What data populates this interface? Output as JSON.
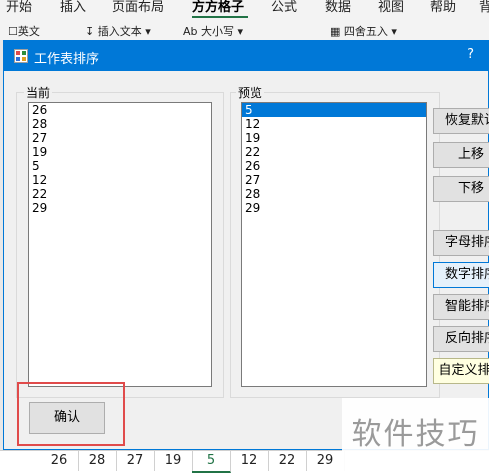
{
  "ribbon": {
    "tabs": [
      "开始",
      "插入",
      "页面布局",
      "方方格子",
      "公式",
      "数据",
      "视图",
      "帮助",
      "背"
    ],
    "toolbar": [
      "英文",
      "插入文本",
      "大小写",
      "四舍五入"
    ]
  },
  "dialog": {
    "title": "工作表排序",
    "help": "?",
    "current_label": "当前",
    "preview_label": "预览",
    "current_items": [
      "26",
      "28",
      "27",
      "19",
      "5",
      "12",
      "22",
      "29"
    ],
    "preview_items": [
      "5",
      "12",
      "19",
      "22",
      "26",
      "27",
      "28",
      "29"
    ],
    "preview_selected": "5",
    "buttons": {
      "restore": "恢复默认",
      "move_up": "上移",
      "move_down": "下移",
      "alpha_sort": "字母排序",
      "numeric_sort": "数字排序",
      "smart_sort": "智能排序",
      "reverse_sort": "反向排序",
      "custom_sort": "自定义排序"
    },
    "ok": "确认"
  },
  "sheet_tabs": [
    "26",
    "28",
    "27",
    "19",
    "5",
    "12",
    "22",
    "29"
  ],
  "sheet_tab_selected": "5",
  "watermark": "软件技巧",
  "colors": {
    "title_bar": "#0078d7",
    "highlight": "#e04b4b",
    "excel_green": "#217346"
  }
}
